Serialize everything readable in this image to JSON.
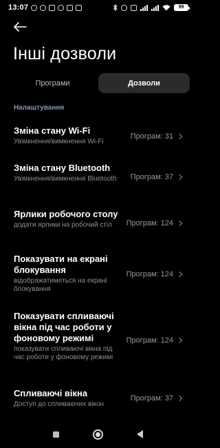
{
  "status_bar": {
    "time": "13:07",
    "battery": "99",
    "left_icons": [
      "alarm-icon",
      "clock-icon",
      "notification-icon",
      "cloud-icon",
      "mail-icon",
      "sim-icon"
    ],
    "right_icons": [
      "bluetooth-icon",
      "vibrate-icon",
      "nfc-icon",
      "signal-bars-icon",
      "signal-bars-icon",
      "wifi-icon"
    ]
  },
  "header": {
    "back_icon": "arrow-left-icon",
    "title": "Інші дозволи"
  },
  "tabs": [
    {
      "label": "Програми",
      "active": false
    },
    {
      "label": "Дозволи",
      "active": true
    }
  ],
  "section": {
    "title": "Налаштування"
  },
  "rows": [
    {
      "title": "Зміна стану Wi-Fi",
      "subtitle": "Увімкнення/вимкнення Wi-Fi",
      "value": "Програм: 31"
    },
    {
      "title": "Зміна стану Bluetooth",
      "subtitle": "Увімкнення/вимкнення Bluetooth",
      "value": "Програм: 37"
    },
    {
      "title": "Ярлики робочого столу",
      "subtitle": "додати ярлики на робочий стіл",
      "value": "Програм: 124"
    },
    {
      "title": "Показувати на екрані блокування",
      "subtitle": "відображатиметься на екрані блокування",
      "value": "Програм: 124"
    },
    {
      "title": "Показувати спливаючі вікна під час роботи у фоновому режимі",
      "subtitle": "показувати спливаючі вікна під час роботи у фоновому режимі",
      "value": "Програм: 124"
    },
    {
      "title": "Спливаючі вікна",
      "subtitle": "Доступ до спливаючих вікон",
      "value": "Програм: 37"
    }
  ],
  "nav": {
    "recents_icon": "square-icon",
    "home_icon": "circle-icon",
    "back_icon": "triangle-back-icon"
  },
  "colors": {
    "background": "#000000",
    "section_header": "#8a96b8",
    "tab_active_bg": "#2b2b2b"
  }
}
